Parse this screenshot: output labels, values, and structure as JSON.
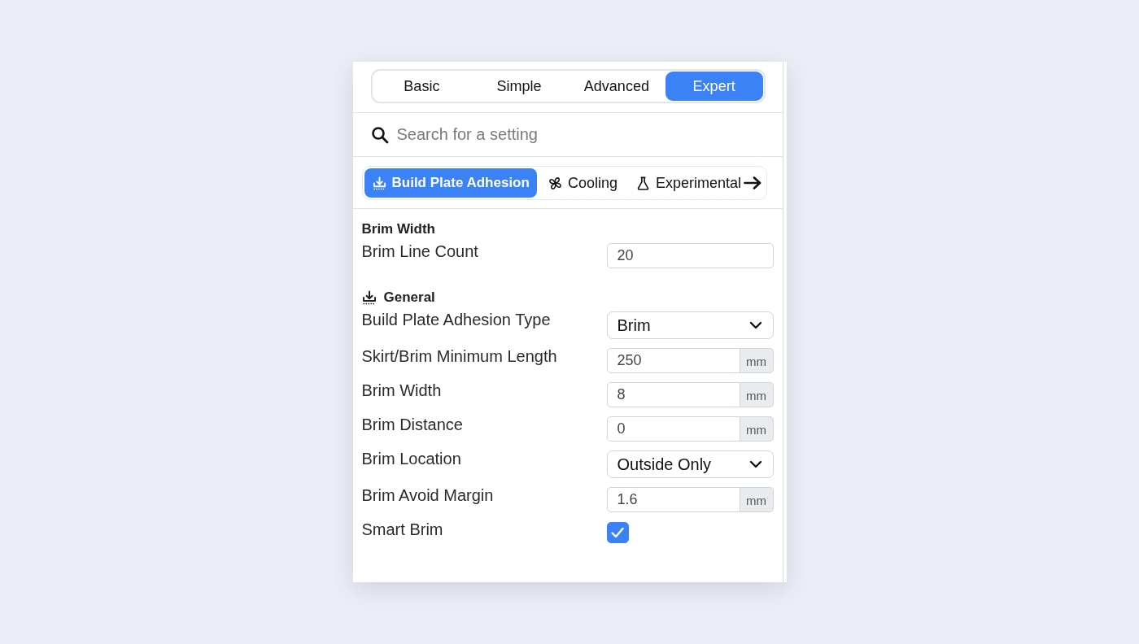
{
  "mode_tabs": [
    {
      "label": "Basic",
      "selected": false
    },
    {
      "label": "Simple",
      "selected": false
    },
    {
      "label": "Advanced",
      "selected": false
    },
    {
      "label": "Expert",
      "selected": true
    }
  ],
  "search": {
    "placeholder": "Search for a setting"
  },
  "categories": [
    {
      "label": "Build Plate Adhesion",
      "selected": true
    },
    {
      "label": "Cooling",
      "selected": false
    },
    {
      "label": "Experimental",
      "selected": false
    }
  ],
  "sections": [
    {
      "title": "Brim Width",
      "settings": [
        {
          "kind": "number",
          "label": "Brim Line Count",
          "value": "20"
        }
      ]
    },
    {
      "title": "General",
      "settings": [
        {
          "kind": "select",
          "label": "Build Plate Adhesion Type",
          "value": "Brim"
        },
        {
          "kind": "number",
          "label": "Skirt/Brim Minimum Length",
          "value": "250",
          "unit": "mm"
        },
        {
          "kind": "number",
          "label": "Brim Width",
          "value": "8",
          "unit": "mm"
        },
        {
          "kind": "number",
          "label": "Brim Distance",
          "value": "0",
          "unit": "mm"
        },
        {
          "kind": "select",
          "label": "Brim Location",
          "value": "Outside Only"
        },
        {
          "kind": "number",
          "label": "Brim Avoid Margin",
          "value": "1.6",
          "unit": "mm"
        },
        {
          "kind": "checkbox",
          "label": "Smart Brim",
          "checked": true
        }
      ]
    }
  ]
}
